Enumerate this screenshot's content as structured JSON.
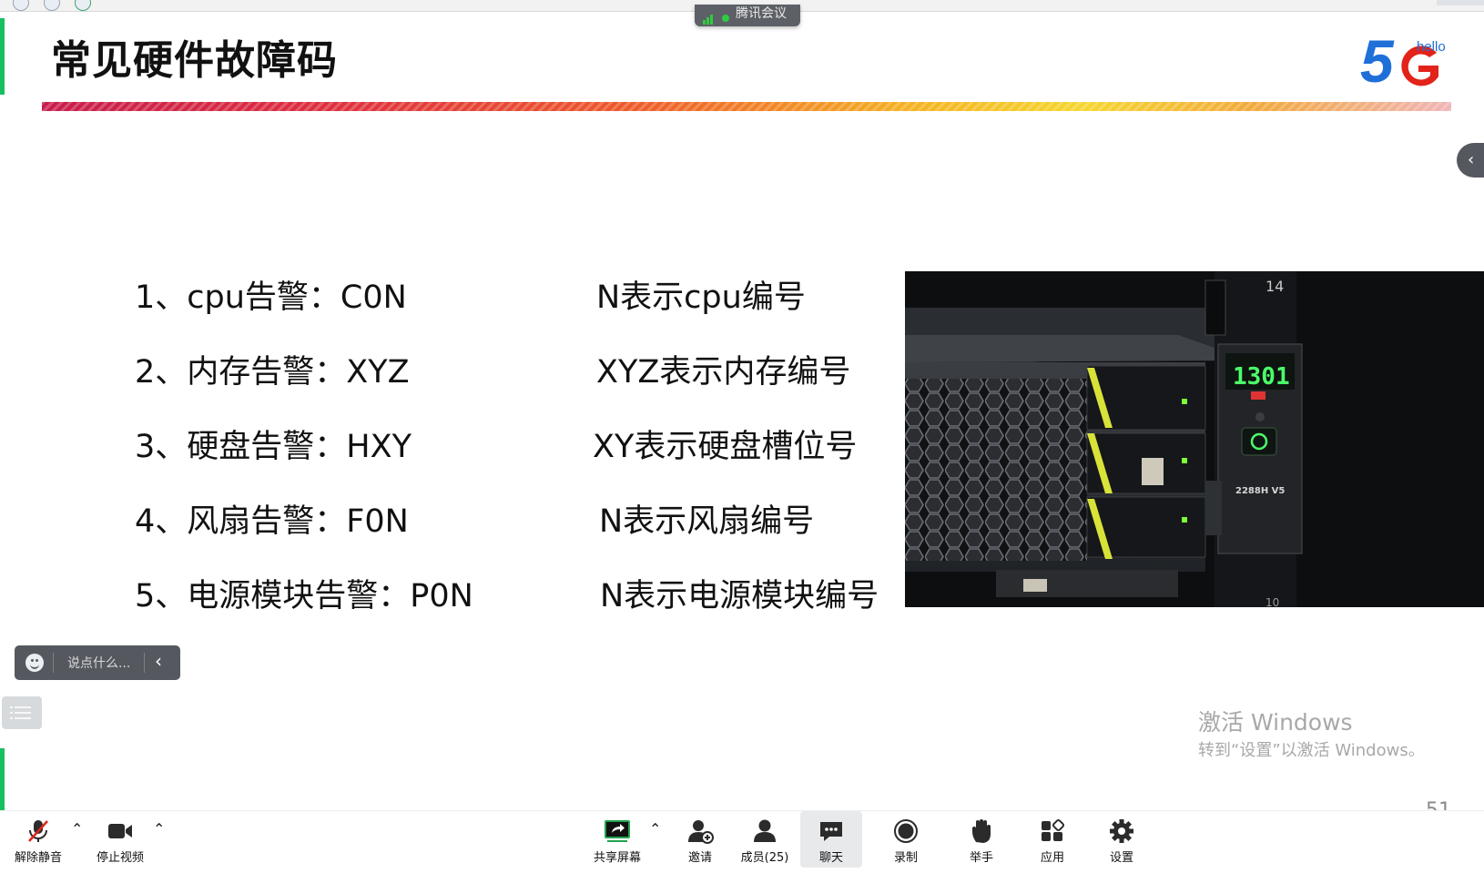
{
  "meeting": {
    "app_name": "腾讯会议"
  },
  "slide": {
    "title": "常见硬件故障码",
    "rows": [
      {
        "code": "1、cpu告警：C0N",
        "meaning": "N表示cpu编号"
      },
      {
        "code": "2、内存告警：XYZ",
        "meaning": "XYZ表示内存编号"
      },
      {
        "code": "3、硬盘告警：HXY",
        "meaning": "XY表示硬盘槽位号"
      },
      {
        "code": "4、风扇告警：F0N",
        "meaning": "N表示风扇编号"
      },
      {
        "code": "5、电源模块告警：P0N",
        "meaning": "N表示电源模块编号"
      }
    ],
    "logo": {
      "mark": "5G",
      "tag": "hello"
    },
    "page_number": "51",
    "photo": {
      "rack_top_label": "14",
      "rack_bottom_label": "10",
      "display_code": "1301",
      "model_label": "2288H V5"
    }
  },
  "chat": {
    "placeholder": "说点什么..."
  },
  "watermark": {
    "line1": "激活 Windows",
    "line2": "转到“设置”以激活 Windows。"
  },
  "toolbar": {
    "unmute": "解除静音",
    "stop_video": "停止视频",
    "share_screen": "共享屏幕",
    "invite": "邀请",
    "members": "成员(25)",
    "chat": "聊天",
    "record": "录制",
    "raise_hand": "举手",
    "apps": "应用",
    "settings": "设置"
  },
  "colors": {
    "accent_green": "#16c060",
    "toolbar_dark": "#55595f",
    "logo_blue": "#1f6fd8",
    "logo_red": "#e2231a"
  },
  "icons": [
    "mic-muted-icon",
    "video-camera-icon",
    "share-screen-icon",
    "invite-person-icon",
    "members-icon",
    "chat-bubble-icon",
    "record-icon",
    "hand-icon",
    "apps-grid-icon",
    "gear-icon",
    "emoji-icon",
    "list-icon",
    "chevron-left-icon",
    "signal-icon"
  ]
}
